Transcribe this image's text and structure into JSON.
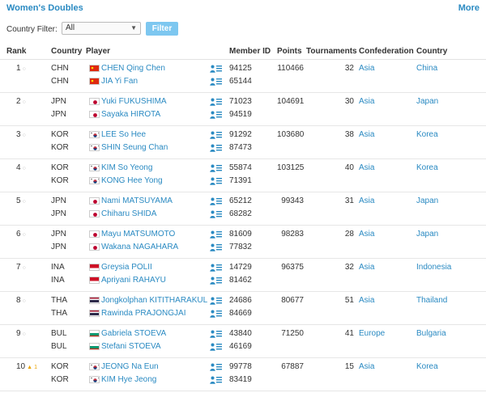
{
  "header": {
    "title": "Women's Doubles",
    "more_label": "More"
  },
  "filter": {
    "label": "Country Filter:",
    "selected": "All",
    "button_label": "Filter"
  },
  "columns": {
    "rank": "Rank",
    "country": "Country",
    "player": "Player",
    "member_id": "Member ID",
    "points": "Points",
    "tournaments": "Tournaments",
    "confederation": "Confederation",
    "country_name": "Country"
  },
  "rows": [
    {
      "rank": "1",
      "change": "none",
      "points": "110466",
      "tournaments": "32",
      "confederation": "Asia",
      "country": "China",
      "players": [
        {
          "code": "CHN",
          "name": "CHEN Qing Chen",
          "member_id": "94125",
          "flag": "china"
        },
        {
          "code": "CHN",
          "name": "JIA Yi Fan",
          "member_id": "65144",
          "flag": "china"
        }
      ]
    },
    {
      "rank": "2",
      "change": "none",
      "points": "104691",
      "tournaments": "30",
      "confederation": "Asia",
      "country": "Japan",
      "players": [
        {
          "code": "JPN",
          "name": "Yuki FUKUSHIMA",
          "member_id": "71023",
          "flag": "japan"
        },
        {
          "code": "JPN",
          "name": "Sayaka HIROTA",
          "member_id": "94519",
          "flag": "japan"
        }
      ]
    },
    {
      "rank": "3",
      "change": "none",
      "points": "103680",
      "tournaments": "38",
      "confederation": "Asia",
      "country": "Korea",
      "players": [
        {
          "code": "KOR",
          "name": "LEE So Hee",
          "member_id": "91292",
          "flag": "korea"
        },
        {
          "code": "KOR",
          "name": "SHIN Seung Chan",
          "member_id": "87473",
          "flag": "korea"
        }
      ]
    },
    {
      "rank": "4",
      "change": "none",
      "points": "103125",
      "tournaments": "40",
      "confederation": "Asia",
      "country": "Korea",
      "players": [
        {
          "code": "KOR",
          "name": "KIM So Yeong",
          "member_id": "55874",
          "flag": "korea"
        },
        {
          "code": "KOR",
          "name": "KONG Hee Yong",
          "member_id": "71391",
          "flag": "korea"
        }
      ]
    },
    {
      "rank": "5",
      "change": "none",
      "points": "99343",
      "tournaments": "31",
      "confederation": "Asia",
      "country": "Japan",
      "players": [
        {
          "code": "JPN",
          "name": "Nami MATSUYAMA",
          "member_id": "65212",
          "flag": "japan"
        },
        {
          "code": "JPN",
          "name": "Chiharu SHIDA",
          "member_id": "68282",
          "flag": "japan"
        }
      ]
    },
    {
      "rank": "6",
      "change": "none",
      "points": "98283",
      "tournaments": "28",
      "confederation": "Asia",
      "country": "Japan",
      "players": [
        {
          "code": "JPN",
          "name": "Mayu MATSUMOTO",
          "member_id": "81609",
          "flag": "japan"
        },
        {
          "code": "JPN",
          "name": "Wakana NAGAHARA",
          "member_id": "77832",
          "flag": "japan"
        }
      ]
    },
    {
      "rank": "7",
      "change": "none",
      "points": "96375",
      "tournaments": "32",
      "confederation": "Asia",
      "country": "Indonesia",
      "players": [
        {
          "code": "INA",
          "name": "Greysia POLII",
          "member_id": "14729",
          "flag": "indonesia"
        },
        {
          "code": "INA",
          "name": "Apriyani RAHAYU",
          "member_id": "81462",
          "flag": "indonesia"
        }
      ]
    },
    {
      "rank": "8",
      "change": "none",
      "points": "80677",
      "tournaments": "51",
      "confederation": "Asia",
      "country": "Thailand",
      "players": [
        {
          "code": "THA",
          "name": "Jongkolphan KITITHARAKUL",
          "member_id": "24686",
          "flag": "thailand"
        },
        {
          "code": "THA",
          "name": "Rawinda PRAJONGJAI",
          "member_id": "84669",
          "flag": "thailand"
        }
      ]
    },
    {
      "rank": "9",
      "change": "none",
      "points": "71250",
      "tournaments": "41",
      "confederation": "Europe",
      "country": "Bulgaria",
      "players": [
        {
          "code": "BUL",
          "name": "Gabriela STOEVA",
          "member_id": "43840",
          "flag": "bulgaria"
        },
        {
          "code": "BUL",
          "name": "Stefani STOEVA",
          "member_id": "46169",
          "flag": "bulgaria"
        }
      ]
    },
    {
      "rank": "10",
      "change": "up",
      "change_value": "1",
      "points": "67887",
      "tournaments": "15",
      "confederation": "Asia",
      "country": "Korea",
      "players": [
        {
          "code": "KOR",
          "name": "JEONG Na Eun",
          "member_id": "99778",
          "flag": "korea"
        },
        {
          "code": "KOR",
          "name": "KIM Hye Jeong",
          "member_id": "83419",
          "flag": "korea"
        }
      ]
    }
  ],
  "colors": {
    "link": "#2a8ac2",
    "button": "#7dc7f0",
    "trend_up": "#e8a200"
  }
}
